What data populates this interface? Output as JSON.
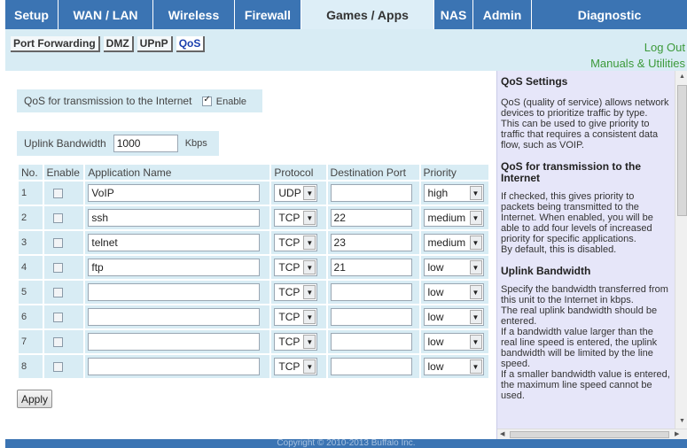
{
  "nav": {
    "tabs": [
      {
        "label": "Setup",
        "width": 60
      },
      {
        "label": "WAN / LAN",
        "width": 107
      },
      {
        "label": "Wireless",
        "width": 92
      },
      {
        "label": "Firewall",
        "width": 75
      },
      {
        "label": "Games / Apps",
        "width": 150
      },
      {
        "label": "NAS",
        "width": 44
      },
      {
        "label": "Admin",
        "width": 66
      },
      {
        "label": "Diagnostic",
        "width": 175
      }
    ],
    "active": "Games / Apps"
  },
  "subnav": {
    "tabs": [
      "Port Forwarding",
      "DMZ",
      "UPnP",
      "QoS"
    ],
    "active": "QoS",
    "logout": "Log Out",
    "manuals": "Manuals & Utilities"
  },
  "qos": {
    "enable_label": "QoS for transmission to the Internet",
    "enable_checkbox_label": "Enable",
    "enabled": true,
    "uplink_label": "Uplink Bandwidth",
    "uplink_value": "1000",
    "uplink_unit": "Kbps"
  },
  "table": {
    "headers": [
      "No.",
      "Enable",
      "Application Name",
      "Protocol",
      "Destination Port",
      "Priority"
    ],
    "rows": [
      {
        "no": "1",
        "name": "VoIP",
        "protocol": "UDP",
        "port": "",
        "priority": "high"
      },
      {
        "no": "2",
        "name": "ssh",
        "protocol": "TCP",
        "port": "22",
        "priority": "medium"
      },
      {
        "no": "3",
        "name": "telnet",
        "protocol": "TCP",
        "port": "23",
        "priority": "medium"
      },
      {
        "no": "4",
        "name": "ftp",
        "protocol": "TCP",
        "port": "21",
        "priority": "low"
      },
      {
        "no": "5",
        "name": "",
        "protocol": "TCP",
        "port": "",
        "priority": "low"
      },
      {
        "no": "6",
        "name": "",
        "protocol": "TCP",
        "port": "",
        "priority": "low"
      },
      {
        "no": "7",
        "name": "",
        "protocol": "TCP",
        "port": "",
        "priority": "low"
      },
      {
        "no": "8",
        "name": "",
        "protocol": "TCP",
        "port": "",
        "priority": "low"
      }
    ]
  },
  "apply_label": "Apply",
  "help": {
    "title": "QoS Settings",
    "intro": "QoS (quality of service) allows network devices to prioritize traffic by type.\nThis can be used to give priority to traffic that requires a consistent data flow, such as VOIP.",
    "section1_title": "QoS for transmission to the Internet",
    "section1_text": "If checked, this gives priority to packets being transmitted to the Internet. When enabled, you will be able to add four levels of increased priority for specific applications.\nBy default, this is disabled.",
    "section2_title": "Uplink Bandwidth",
    "section2_text": "Specify the bandwidth transferred from this unit to the Internet in kbps.\nThe real uplink bandwidth should be entered.\nIf a bandwidth value larger than the real line speed is entered, the uplink bandwidth will be limited by the line speed.\nIf a smaller bandwidth value is entered, the maximum line speed cannot be used."
  },
  "footer": "Copyright © 2010-2013 Buffalo Inc."
}
